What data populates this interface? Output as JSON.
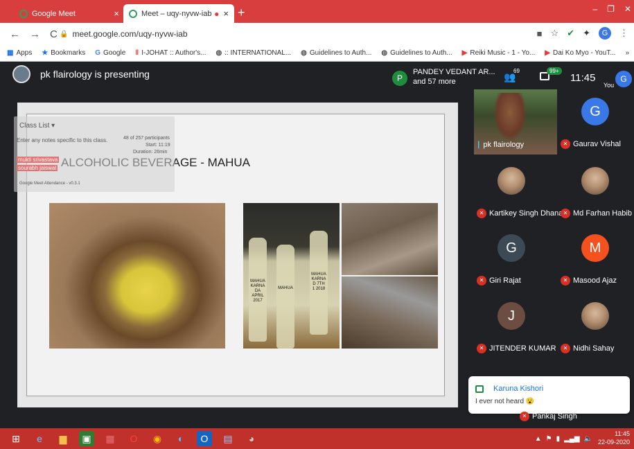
{
  "browser": {
    "tabs": [
      {
        "title": "Google Meet",
        "close": "×"
      },
      {
        "title": "Meet – uqy-nyvw-iab",
        "close": "×"
      }
    ],
    "new_tab": "+",
    "window_controls": {
      "minimize": "–",
      "restore": "❐",
      "close": "✕"
    },
    "nav": {
      "back": "←",
      "forward": "→",
      "reload": "C"
    },
    "url": "meet.google.com/uqy-nyvw-iab",
    "extension_avatar": "G",
    "bookmarks": [
      {
        "label": "Apps",
        "icon": "apps-grid-icon"
      },
      {
        "label": "Bookmarks",
        "icon": "star-icon"
      },
      {
        "label": "Google",
        "icon": "google-icon"
      },
      {
        "label": "I-JOHAT :: Author's...",
        "icon": "journal-icon"
      },
      {
        "label": ":: INTERNATIONAL...",
        "icon": "globe-icon"
      },
      {
        "label": "Guidelines to Auth...",
        "icon": "globe-icon"
      },
      {
        "label": "Guidelines to Auth...",
        "icon": "globe-icon"
      },
      {
        "label": "Reiki Music - 1 - Yo...",
        "icon": "youtube-icon"
      },
      {
        "label": "Dai Ko Myo - YouT...",
        "icon": "youtube-icon"
      }
    ],
    "bookmarks_more": "»"
  },
  "meet": {
    "presenting_text": "pk flairology is presenting",
    "pinned": {
      "avatar": "P",
      "name_line1": "PANDEY VEDANT AR...",
      "name_line2": "and 57 more"
    },
    "people_count": "69",
    "chat_badge": "99+",
    "clock": "11:45",
    "you_label": "You",
    "you_avatar": "G",
    "slide": {
      "title": "ALCOHOLIC BEVERAGE - MAHUA",
      "bottle_labels": [
        "MAHUA KARNA DA APRIL 2017",
        "MAHUA",
        "MAHUA KARNA D 7TH 1 2018"
      ]
    },
    "overlay": {
      "header": "Class List ▾",
      "note": "Enter any notes specific to this class.",
      "count": "48 of 257 participants",
      "start": "Start: 11:19",
      "duration": "Duration: 26min",
      "row1": "mukti srivastava",
      "row2": "sourabh jaiswal",
      "footer": "Google Meet Attendance - v0.3.1"
    },
    "participants": [
      {
        "name": "pk flairology",
        "initial": "",
        "color": "",
        "photo": true,
        "muted": false
      },
      {
        "name": "Gaurav Vishal",
        "initial": "G",
        "color": "#3b78e7",
        "photo": false,
        "muted": true
      },
      {
        "name": "Kartikey Singh Dhanai",
        "initial": "",
        "color": "",
        "photo": true,
        "muted": true
      },
      {
        "name": "Md Farhan Habib Khan",
        "initial": "",
        "color": "",
        "photo": true,
        "muted": true
      },
      {
        "name": "Giri Rajat",
        "initial": "G",
        "color": "#3c4a55",
        "photo": false,
        "muted": true
      },
      {
        "name": "Masood Ajaz",
        "initial": "M",
        "color": "#f4511e",
        "photo": false,
        "muted": true
      },
      {
        "name": "JITENDER KUMAR",
        "initial": "J",
        "color": "#6d4c41",
        "photo": false,
        "muted": true
      },
      {
        "name": "Nidhi Sahay",
        "initial": "",
        "color": "",
        "photo": true,
        "muted": true
      }
    ],
    "chat_toast": {
      "sender": "Karuna Kishori",
      "message": "I ever not heard 😮"
    },
    "partially_hidden": "Pankaj Singh"
  },
  "taskbar": {
    "time": "11:45",
    "date": "22-09-2020"
  }
}
